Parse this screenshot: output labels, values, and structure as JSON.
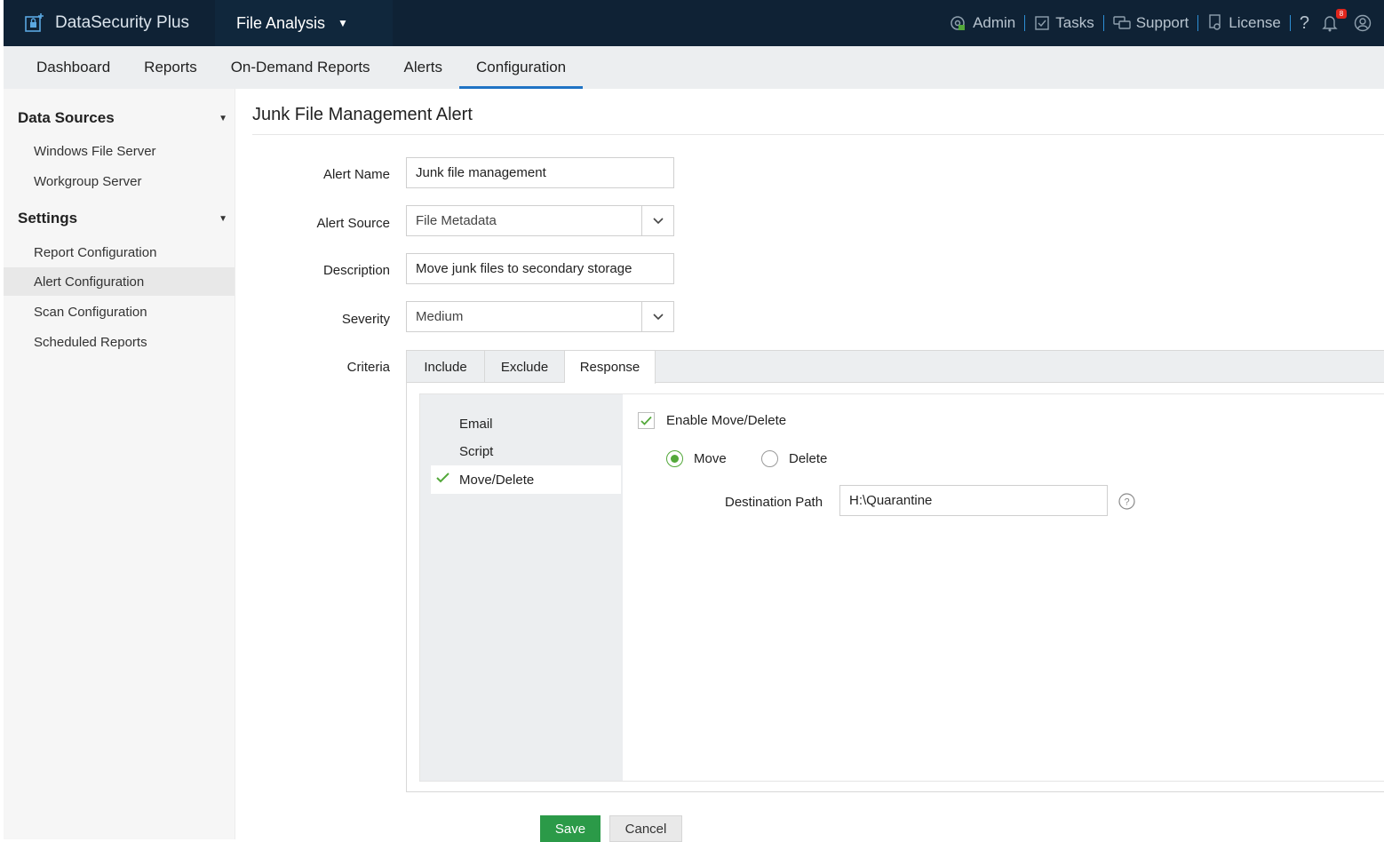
{
  "brand": {
    "name": "DataSecurity Plus"
  },
  "module": {
    "name": "File Analysis"
  },
  "toplinks": {
    "admin": "Admin",
    "tasks": "Tasks",
    "support": "Support",
    "license": "License",
    "help": "?",
    "notif_count": "8"
  },
  "nav": [
    "Dashboard",
    "Reports",
    "On-Demand Reports",
    "Alerts",
    "Configuration"
  ],
  "sidebar": {
    "data_sources": {
      "title": "Data Sources",
      "items": [
        "Windows File Server",
        "Workgroup Server"
      ]
    },
    "settings": {
      "title": "Settings",
      "items": [
        "Report Configuration",
        "Alert Configuration",
        "Scan Configuration",
        "Scheduled Reports"
      ]
    }
  },
  "page": {
    "title": "Junk File Management Alert"
  },
  "form": {
    "alert_name_label": "Alert Name",
    "alert_name_value": "Junk file management",
    "alert_source_label": "Alert Source",
    "alert_source_value": "File Metadata",
    "description_label": "Description",
    "description_value": "Move junk files to secondary storage",
    "severity_label": "Severity",
    "severity_value": "Medium",
    "criteria_label": "Criteria"
  },
  "criteria_tabs": [
    "Include",
    "Exclude",
    "Response"
  ],
  "response_types": [
    "Email",
    "Script",
    "Move/Delete"
  ],
  "move_delete": {
    "enable_label": "Enable Move/Delete",
    "move_label": "Move",
    "delete_label": "Delete",
    "dest_label": "Destination Path",
    "dest_value": "H:\\Quarantine"
  },
  "buttons": {
    "save": "Save",
    "cancel": "Cancel"
  },
  "colors": {
    "topbar": "#0f2235",
    "accent": "#1f73c4",
    "save": "#2b9a48",
    "check": "#53a83a"
  }
}
